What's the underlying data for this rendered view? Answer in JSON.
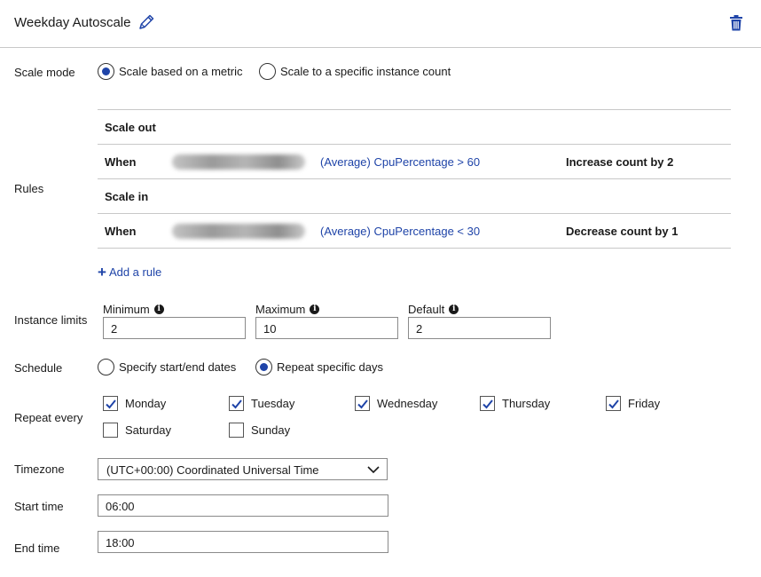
{
  "header": {
    "title": "Weekday Autoscale",
    "edit_icon": "pencil-icon",
    "delete_icon": "trash-icon"
  },
  "scale_mode": {
    "label": "Scale mode",
    "options": [
      "Scale based on a metric",
      "Scale to a specific instance count"
    ],
    "selected": "Scale based on a metric"
  },
  "rules": {
    "label": "Rules",
    "scale_out": {
      "heading": "Scale out",
      "when": "When",
      "condition": "(Average) CpuPercentage > 60",
      "action": "Increase count by 2"
    },
    "scale_in": {
      "heading": "Scale in",
      "when": "When",
      "condition": "(Average) CpuPercentage < 30",
      "action": "Decrease count by 1"
    },
    "add_rule": "Add a rule"
  },
  "instance_limits": {
    "label": "Instance limits",
    "minimum": {
      "label": "Minimum",
      "value": "2"
    },
    "maximum": {
      "label": "Maximum",
      "value": "10"
    },
    "default": {
      "label": "Default",
      "value": "2"
    }
  },
  "schedule": {
    "label": "Schedule",
    "options": [
      "Specify start/end dates",
      "Repeat specific days"
    ],
    "selected": "Repeat specific days"
  },
  "repeat_every": {
    "label": "Repeat every",
    "days": [
      {
        "name": "Monday",
        "checked": true
      },
      {
        "name": "Tuesday",
        "checked": true
      },
      {
        "name": "Wednesday",
        "checked": true
      },
      {
        "name": "Thursday",
        "checked": true
      },
      {
        "name": "Friday",
        "checked": true
      },
      {
        "name": "Saturday",
        "checked": false
      },
      {
        "name": "Sunday",
        "checked": false
      }
    ]
  },
  "timezone": {
    "label": "Timezone",
    "value": "(UTC+00:00) Coordinated Universal Time"
  },
  "start_time": {
    "label": "Start time",
    "value": "06:00"
  },
  "end_time": {
    "label": "End time",
    "value": "18:00"
  },
  "colors": {
    "accent": "#1f44a8",
    "border": "#8a8a8a",
    "divider": "#c8c8c8"
  }
}
